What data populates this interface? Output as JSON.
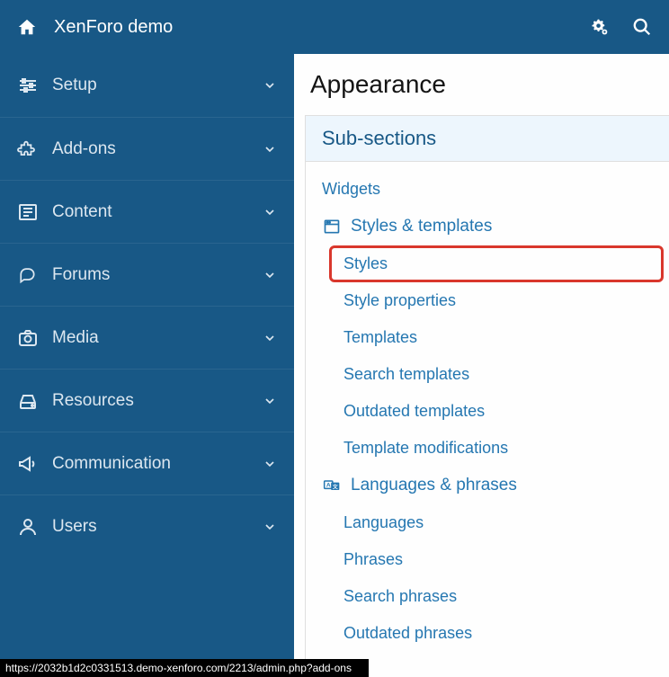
{
  "header": {
    "title": "XenForo demo"
  },
  "sidebar": {
    "items": [
      {
        "label": "Setup",
        "icon": "sliders"
      },
      {
        "label": "Add-ons",
        "icon": "puzzle"
      },
      {
        "label": "Content",
        "icon": "newspaper"
      },
      {
        "label": "Forums",
        "icon": "comments"
      },
      {
        "label": "Media",
        "icon": "camera"
      },
      {
        "label": "Resources",
        "icon": "hdd"
      },
      {
        "label": "Communication",
        "icon": "bullhorn"
      },
      {
        "label": "Users",
        "icon": "user"
      }
    ]
  },
  "main": {
    "title": "Appearance",
    "sub_header": "Sub-sections",
    "links": {
      "widgets": "Widgets",
      "styles_templates": "Styles & templates",
      "styles": "Styles",
      "style_properties": "Style properties",
      "templates": "Templates",
      "search_templates": "Search templates",
      "outdated_templates": "Outdated templates",
      "template_modifications": "Template modifications",
      "languages_phrases": "Languages & phrases",
      "languages": "Languages",
      "phrases": "Phrases",
      "search_phrases": "Search phrases",
      "outdated_phrases": "Outdated phrases"
    }
  },
  "status_bar": "https://2032b1d2c0331513.demo-xenforo.com/2213/admin.php?add-ons"
}
